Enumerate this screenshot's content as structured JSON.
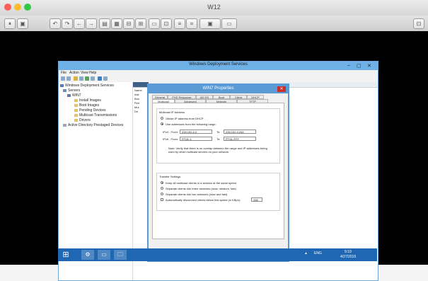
{
  "host": {
    "title": "W12",
    "traffic_colors": [
      "#fc5f57",
      "#fdbc2e",
      "#33c748"
    ],
    "toolbar_glyphs": [
      "⏸",
      "▣",
      "↶",
      "↷",
      "←",
      "→",
      "▤",
      "▦",
      "⊟",
      "⊞",
      "▭",
      "⊡",
      "≡",
      "⌗"
    ]
  },
  "mmc": {
    "title": "Windows Deployment Services",
    "controls": [
      "–",
      "▢",
      "✕"
    ],
    "menu": [
      "File",
      "Action",
      "View",
      "Help"
    ],
    "tree": [
      {
        "label": "Windows Deployment Services",
        "indent": 0
      },
      {
        "label": "Servers",
        "indent": 1
      },
      {
        "label": "WIN7",
        "indent": 2
      },
      {
        "label": "Install Images",
        "indent": 3
      },
      {
        "label": "Boot Images",
        "indent": 3
      },
      {
        "label": "Pending Devices",
        "indent": 3
      },
      {
        "label": "Multicast Transmissions",
        "indent": 3
      },
      {
        "label": "Drivers",
        "indent": 3
      },
      {
        "label": "Active Directory Prestaged Devices",
        "indent": 1
      }
    ],
    "list_rows": [
      "Name",
      "Inst",
      "Boo",
      "Pen",
      "Mul",
      "Dri"
    ]
  },
  "dialog": {
    "title": "WIN7 Properties",
    "close": "✕",
    "tabs_row1": [
      "General",
      "PXE Response",
      "AD DS",
      "Boot",
      "Client",
      "DHCP"
    ],
    "tabs_row2": [
      "Multicast",
      "Advanced",
      "Network",
      "TFTP"
    ],
    "active_tab": "Multicast",
    "ip_group": {
      "title": "Multicast IP Address",
      "option1": "Obtain IP address from DHCP",
      "option2": "Use addresses from the following range:",
      "ipv4_from_label": "IPv4 - From:",
      "ipv4_from": "239.192.0.2",
      "ipv4_to_label": "To:",
      "ipv4_to": "239.192.0.254",
      "ipv6_from_label": "IPv6 - From:",
      "ipv6_from": "FF15::1",
      "ipv6_to_label": "To:",
      "ipv6_to": "FF15::FFF",
      "note": "Note: Verify that there is no overlap between the range and IP addresses being used by other multicast servers on your network."
    },
    "transfer_group": {
      "title": "Transfer Settings",
      "opt1": "Keep all multicast clients in a session at the same speed",
      "opt2": "Separate clients into three sessions (slow, medium, fast)",
      "opt3": "Separate clients into two sessions (slow and fast)",
      "opt4": "Automatically disconnect clients below this speed (in KBps):",
      "speed": "256"
    },
    "buttons": {
      "ok": "OK",
      "cancel": "Cancel",
      "apply": "Apply"
    }
  },
  "taskbar": {
    "start": "⊞",
    "apps": [
      "⚙",
      "▭",
      "🗀"
    ],
    "tray": [
      "▲",
      "ENG",
      "9:19",
      "4/27/2015"
    ]
  },
  "colors": {
    "accent": "#5b9bd5",
    "taskbar": "#1f67b3",
    "close": "#c9302c"
  }
}
